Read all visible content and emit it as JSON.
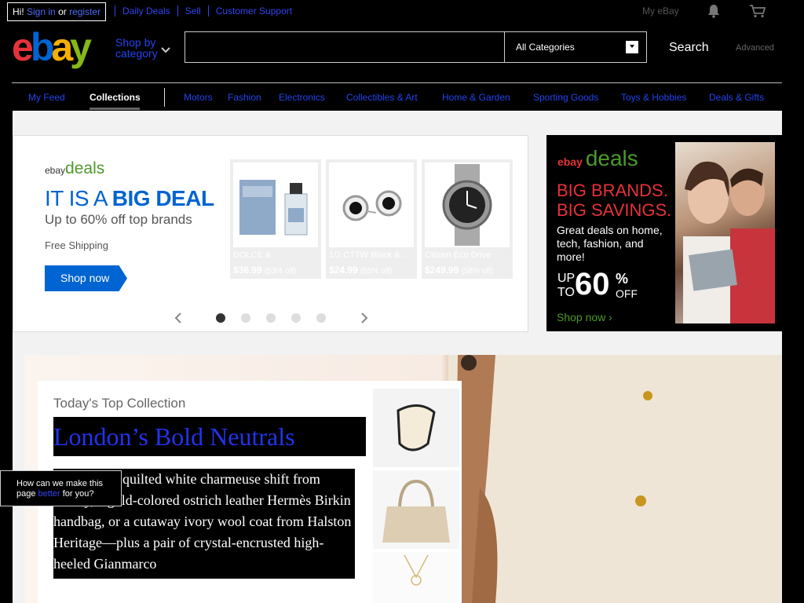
{
  "topbar": {
    "greeting": "Hi!",
    "sign_in": "Sign in",
    "or": "or",
    "register": "register",
    "links": [
      "Daily Deals",
      "Sell",
      "Customer Support"
    ],
    "my_ebay": "My eBay"
  },
  "header": {
    "logo": [
      "e",
      "b",
      "a",
      "y"
    ],
    "shop_by_line1": "Shop by",
    "shop_by_line2": "category",
    "search_value": "",
    "category_selected": "All Categories",
    "search_button": "Search",
    "advanced": "Advanced"
  },
  "nav": {
    "items": [
      "My Feed",
      "Collections",
      "Motors",
      "Fashion",
      "Electronics",
      "Collectibles & Art",
      "Home & Garden",
      "Sporting Goods",
      "Toys & Hobbies",
      "Deals & Gifts"
    ]
  },
  "deals_banner": {
    "logo_small": "ebay",
    "logo_deals": "deals",
    "headline_prefix": "IT IS A ",
    "headline_bold": "BIG DEAL",
    "subhead": "Up to 60% off top brands",
    "shipping": "Free Shipping",
    "cta": "Shop now",
    "products": [
      {
        "name": "DOLCE &",
        "price": "$36.99",
        "discount": "(53% off)"
      },
      {
        "name": "1/2 CTTW Black &...",
        "price": "$24.99",
        "discount": "(85% off)"
      },
      {
        "name": "Citizen Eco Drive",
        "price": "$249.99",
        "discount": "(58% off)"
      }
    ]
  },
  "side_ad": {
    "logo_small": "ebay",
    "logo_deals": "deals",
    "headline1": "BIG BRANDS.",
    "headline2": "BIG SAVINGS.",
    "body": "Great deals on home, tech, fashion, and more!",
    "up": "UP",
    "to": "TO",
    "number": "60",
    "percent": "%",
    "off": "OFF",
    "cta": "Shop now"
  },
  "collection": {
    "kicker": "Today's Top Collection",
    "title": "London’s Bold Neutrals",
    "desc_first": "quilted white charmeuse shift from",
    "desc_rest": "...wley, a gold-colored ostrich leather Hermès Birkin handbag, or a cutaway ivory wool coat from Halston Heritage—plus a pair of crystal-encrusted high-heeled Gianmarco"
  },
  "feedback": {
    "line1": "How can we make this",
    "line2_prefix": "page ",
    "line2_link": "better",
    "line2_suffix": " for you?"
  }
}
